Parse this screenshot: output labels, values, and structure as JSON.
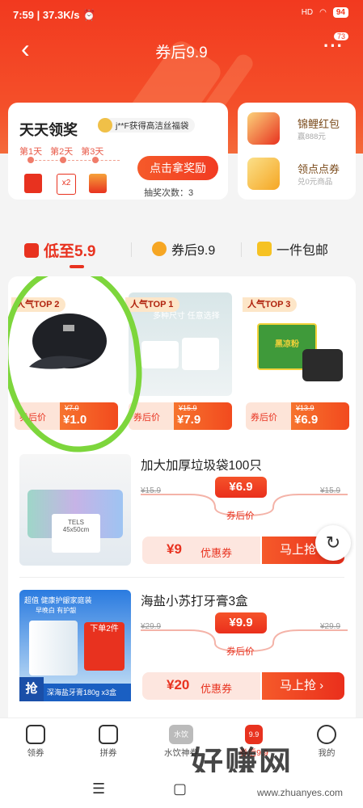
{
  "status_bar": {
    "time": "7:59",
    "speed": "37.3K/s",
    "signal": "HD",
    "battery": "94"
  },
  "nav": {
    "back_icon": "chevron-left-icon",
    "title": "券后9.9",
    "more_icon": "more-dots-icon",
    "badge": "73"
  },
  "lottery": {
    "title": "天天领奖",
    "ticker": "j**F获得高洁丝福袋",
    "days": [
      "第1天",
      "第2天",
      "第3天"
    ],
    "multiplier": "x2",
    "button": "点击拿奖励",
    "count_label": "抽奖次数：3"
  },
  "side_cards": [
    {
      "title": "锦鲤红包",
      "subtitle": "赢888元"
    },
    {
      "title": "领点点券",
      "subtitle": "兑0元商品"
    }
  ],
  "tabs": [
    {
      "label": "低至5.9",
      "active": true
    },
    {
      "label": "券后9.9",
      "active": false
    },
    {
      "label": "一件包邮",
      "active": false
    }
  ],
  "top_items": [
    {
      "tag": "人气TOP 2",
      "price_label": "券后价",
      "original": "¥7.0",
      "price": "¥1.0"
    },
    {
      "tag": "人气TOP 1",
      "price_label": "券后价",
      "original": "¥15.9",
      "price": "¥7.9",
      "img_text": "多种尺寸 任意选择"
    },
    {
      "tag": "人气TOP 3",
      "price_label": "券后价",
      "original": "¥13.9",
      "price": "¥6.9",
      "img_text": "黑凉粉"
    }
  ],
  "products": [
    {
      "name": "加大加厚垃圾袋100只",
      "old": "¥15.9",
      "price": "¥6.9",
      "price_label": "券后价",
      "coupon_amount": "¥9",
      "coupon_label": "优惠券",
      "buy": "马上抢",
      "img_text_1": "TELS",
      "img_text_2": "45x50cm"
    },
    {
      "name": "海盐小苏打牙膏3盒",
      "old": "¥29.9",
      "price": "¥9.9",
      "price_label": "券后价",
      "coupon_amount": "¥20",
      "coupon_label": "优惠券",
      "buy": "马上抢 ›",
      "img_banner": "超值 健康护龈家庭装",
      "img_sub": "早晚白 有护龈",
      "img_badge": "下单2件",
      "img_bottom": "深海盐牙膏180g x3盒",
      "img_tag": "抢"
    }
  ],
  "bottom_nav": [
    {
      "label": "领券",
      "icon": "coupon-icon"
    },
    {
      "label": "拼券",
      "icon": "group-coupon-icon"
    },
    {
      "label": "水饮神券",
      "icon": "drink-icon",
      "icon_text": "水饮"
    },
    {
      "label": "券后9.9",
      "icon": "99-icon",
      "icon_text": "9.9",
      "active": true
    },
    {
      "label": "我的",
      "icon": "profile-icon"
    }
  ],
  "system_nav": {
    "menu": "☰",
    "home": "▢",
    "back": "◁"
  },
  "watermark": {
    "main": "好赚网",
    "url": "www.zhuanyes.com"
  },
  "colors": {
    "primary": "#e8321f",
    "highlight_circle": "#7dd63c"
  }
}
